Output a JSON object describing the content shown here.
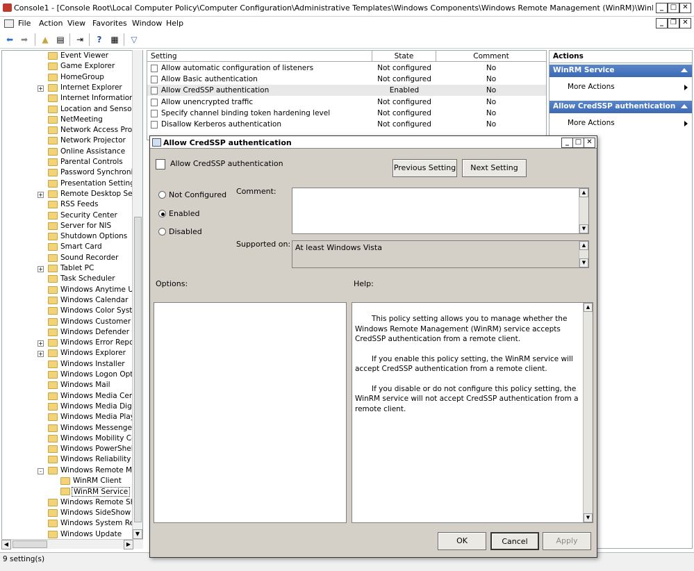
{
  "window": {
    "title": "Console1 - [Console Root\\Local Computer Policy\\Computer Configuration\\Administrative Templates\\Windows Components\\Windows Remote Management (WinRM)\\WinRM S..."
  },
  "menu": [
    "File",
    "Action",
    "View",
    "Favorites",
    "Window",
    "Help"
  ],
  "tree": {
    "items": [
      {
        "label": "Event Viewer",
        "exp": ""
      },
      {
        "label": "Game Explorer",
        "exp": ""
      },
      {
        "label": "HomeGroup",
        "exp": ""
      },
      {
        "label": "Internet Explorer",
        "exp": "+"
      },
      {
        "label": "Internet Information Se",
        "exp": ""
      },
      {
        "label": "Location and Sensors",
        "exp": ""
      },
      {
        "label": "NetMeeting",
        "exp": ""
      },
      {
        "label": "Network Access Protect",
        "exp": ""
      },
      {
        "label": "Network Projector",
        "exp": ""
      },
      {
        "label": "Online Assistance",
        "exp": ""
      },
      {
        "label": "Parental Controls",
        "exp": ""
      },
      {
        "label": "Password Synchronizat",
        "exp": ""
      },
      {
        "label": "Presentation Settings",
        "exp": ""
      },
      {
        "label": "Remote Desktop Servic",
        "exp": "+"
      },
      {
        "label": "RSS Feeds",
        "exp": ""
      },
      {
        "label": "Security Center",
        "exp": ""
      },
      {
        "label": "Server for NIS",
        "exp": ""
      },
      {
        "label": "Shutdown Options",
        "exp": ""
      },
      {
        "label": "Smart Card",
        "exp": ""
      },
      {
        "label": "Sound Recorder",
        "exp": ""
      },
      {
        "label": "Tablet PC",
        "exp": "+"
      },
      {
        "label": "Task Scheduler",
        "exp": ""
      },
      {
        "label": "Windows Anytime Upgr",
        "exp": ""
      },
      {
        "label": "Windows Calendar",
        "exp": ""
      },
      {
        "label": "Windows Color System",
        "exp": ""
      },
      {
        "label": "Windows Customer Exp",
        "exp": ""
      },
      {
        "label": "Windows Defender",
        "exp": ""
      },
      {
        "label": "Windows Error Reportin",
        "exp": "+"
      },
      {
        "label": "Windows Explorer",
        "exp": "+"
      },
      {
        "label": "Windows Installer",
        "exp": ""
      },
      {
        "label": "Windows Logon Options",
        "exp": ""
      },
      {
        "label": "Windows Mail",
        "exp": ""
      },
      {
        "label": "Windows Media Center",
        "exp": ""
      },
      {
        "label": "Windows Media Digital R",
        "exp": ""
      },
      {
        "label": "Windows Media Player",
        "exp": ""
      },
      {
        "label": "Windows Messenger",
        "exp": ""
      },
      {
        "label": "Windows Mobility Cente",
        "exp": ""
      },
      {
        "label": "Windows PowerShell",
        "exp": ""
      },
      {
        "label": "Windows Reliability Ana",
        "exp": ""
      },
      {
        "label": "Windows Remote Mana",
        "exp": "-"
      },
      {
        "label": "WinRM Client",
        "exp": "",
        "child": true
      },
      {
        "label": "WinRM Service",
        "exp": "",
        "child": true,
        "selected": true
      },
      {
        "label": "Windows Remote Shell",
        "exp": ""
      },
      {
        "label": "Windows SideShow",
        "exp": ""
      },
      {
        "label": "Windows System Resou",
        "exp": ""
      },
      {
        "label": "Windows Update",
        "exp": ""
      }
    ]
  },
  "list": {
    "columns": [
      "Setting",
      "State",
      "Comment"
    ],
    "rows": [
      {
        "setting": "Allow automatic configuration of listeners",
        "state": "Not configured",
        "comment": "No"
      },
      {
        "setting": "Allow Basic authentication",
        "state": "Not configured",
        "comment": "No"
      },
      {
        "setting": "Allow CredSSP authentication",
        "state": "Enabled",
        "comment": "No",
        "selected": true
      },
      {
        "setting": "Allow unencrypted traffic",
        "state": "Not configured",
        "comment": "No"
      },
      {
        "setting": "Specify channel binding token hardening level",
        "state": "Not configured",
        "comment": "No"
      },
      {
        "setting": "Disallow Kerberos authentication",
        "state": "Not configured",
        "comment": "No"
      }
    ]
  },
  "actions": {
    "header": "Actions",
    "sections": [
      {
        "title": "WinRM Service",
        "item": "More Actions"
      },
      {
        "title": "Allow CredSSP authentication",
        "item": "More Actions"
      }
    ]
  },
  "status": {
    "text": "9 setting(s)"
  },
  "dialog": {
    "title": "Allow CredSSP authentication",
    "heading": "Allow CredSSP authentication",
    "prev_label": "Previous Setting",
    "next_label": "Next Setting",
    "radio_not_configured": "Not Configured",
    "radio_enabled": "Enabled",
    "radio_disabled": "Disabled",
    "selected_radio": "Enabled",
    "comment_label": "Comment:",
    "comment_value": "",
    "supported_label": "Supported on:",
    "supported_value": "At least Windows Vista",
    "options_label": "Options:",
    "help_label": "Help:",
    "help_paragraphs": [
      "This policy setting allows you to manage whether the Windows Remote Management (WinRM) service accepts CredSSP authentication from a remote client.",
      "If you enable this policy setting, the WinRM service will accept CredSSP authentication from a remote client.",
      "If you disable or do not configure this policy setting, the WinRM service will not accept CredSSP authentication from a remote client."
    ],
    "ok_label": "OK",
    "cancel_label": "Cancel",
    "apply_label": "Apply"
  }
}
